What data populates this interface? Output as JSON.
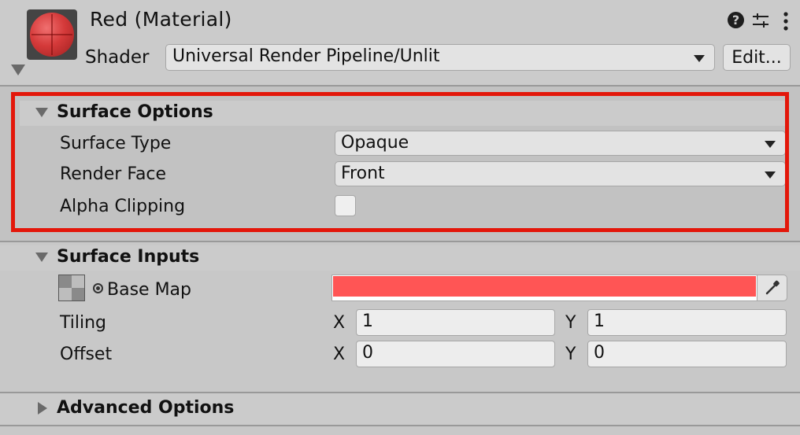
{
  "header": {
    "material_name": "Red (Material)",
    "shader_label": "Shader",
    "shader_value": "Universal Render Pipeline/Unlit",
    "edit_label": "Edit...",
    "help_glyph": "?",
    "icons": [
      "help-icon",
      "presets-icon",
      "more-icon",
      "chevron-down-icon"
    ]
  },
  "surface_options": {
    "title": "Surface Options",
    "highlight_color": "#e3170a",
    "surface_type_label": "Surface Type",
    "surface_type_value": "Opaque",
    "render_face_label": "Render Face",
    "render_face_value": "Front",
    "alpha_clipping_label": "Alpha Clipping",
    "alpha_clipping_checked": false
  },
  "surface_inputs": {
    "title": "Surface Inputs",
    "base_map_label": "Base Map",
    "base_color": "#ff5555",
    "tiling_label": "Tiling",
    "offset_label": "Offset",
    "x_label": "X",
    "y_label": "Y",
    "tiling_x": "1",
    "tiling_y": "1",
    "offset_x": "0",
    "offset_y": "0"
  },
  "advanced_options": {
    "title": "Advanced Options"
  }
}
